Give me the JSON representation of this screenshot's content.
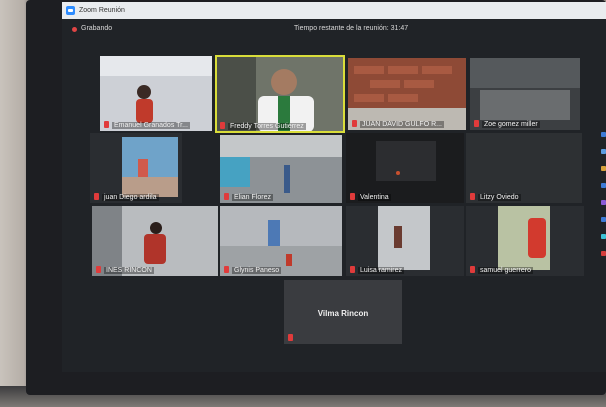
{
  "window": {
    "title": "Zoom Reunión"
  },
  "infobar": {
    "recording": "Grabando",
    "time_remaining": "Tiempo restante de la reunión: 31:47"
  },
  "participants": [
    {
      "name": "Emanuel   Granados Tr..."
    },
    {
      "name": "Freddy Torres Gutiérrez"
    },
    {
      "name": "JUAN DAVID GULFO R..."
    },
    {
      "name": "Zoe gomez miller"
    },
    {
      "name": "juan Diego ardila"
    },
    {
      "name": "Elian Florez"
    },
    {
      "name": "Valentina"
    },
    {
      "name": "Litzy Oviedo"
    },
    {
      "name": "INES RINCON"
    },
    {
      "name": "Glynis Paneso"
    },
    {
      "name": "Luisa ramirez"
    },
    {
      "name": "samuel guerrero"
    },
    {
      "name": "Vilma Rincon"
    }
  ],
  "colors": {
    "active_speaker": "#d9dd3a",
    "muted_icon": "#e03b3b",
    "taskbar": "#1a2f52"
  },
  "taskbar": {
    "icons": [
      "windows-start-icon",
      "search-icon",
      "task-view-icon",
      "file-explorer-icon",
      "chrome-icon",
      "store-icon",
      "zoom-icon"
    ]
  }
}
